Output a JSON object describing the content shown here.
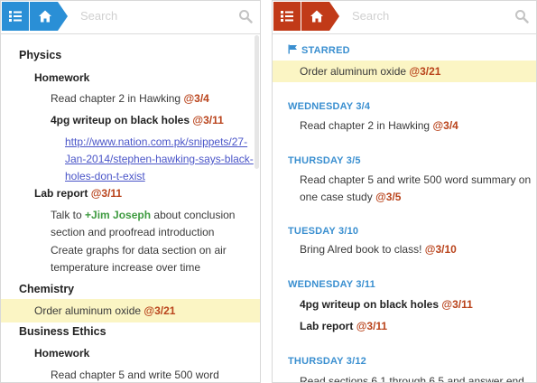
{
  "left": {
    "search_placeholder": "Search",
    "tree": {
      "physics": "Physics",
      "homework": "Homework",
      "item_read_hawking": "Read chapter 2 in Hawking",
      "due_3_4": "@3/4",
      "item_writeup": "4pg writeup on black holes",
      "due_3_11": "@3/11",
      "link_line1": "http://www.nation.com.pk/snippets/27-",
      "link_line2": "Jan-2014/stephen-hawking-says-black-",
      "link_line3": "holes-don-t-exist",
      "lab_report": "Lab report",
      "due_lab": "@3/11",
      "talk_to": "Talk to",
      "mention": "+Jim Joseph",
      "talk_rest": "about conclusion",
      "talk_line2": "section and proofread introduction",
      "graphs_line1": "Create graphs for data section on air",
      "graphs_line2": "temperature increase over time",
      "chemistry": "Chemistry",
      "order": "Order aluminum oxide",
      "due_order": "@3/21",
      "business_ethics": "Business Ethics",
      "homework2": "Homework",
      "read5": "Read chapter 5 and write 500 word"
    }
  },
  "right": {
    "search_placeholder": "Search",
    "starred": "STARRED",
    "starred_item": "Order aluminum oxide",
    "starred_due": "@3/21",
    "wed34": "WEDNESDAY 3/4",
    "wed34_item": "Read chapter 2 in Hawking",
    "wed34_due": "@3/4",
    "thu35": "THURSDAY 3/5",
    "thu35_line1": "Read chapter 5 and write 500 word summary on",
    "thu35_line2": "one case study",
    "thu35_due": "@3/5",
    "tue310": "TUESDAY 3/10",
    "tue310_item": "Bring Alred book to class!",
    "tue310_due": "@3/10",
    "wed311": "WEDNESDAY 3/11",
    "wed311_item1": "4pg writeup on black holes",
    "wed311_due1": "@3/11",
    "wed311_item2": "Lab report",
    "wed311_due2": "@3/11",
    "thu312": "THURSDAY 3/12",
    "thu312_item": "Read sections 6.1 through 6.5 and answer end"
  },
  "colors": {
    "left_accent": "#2a8fd6",
    "right_accent": "#c13a18"
  },
  "icons": [
    "list-icon",
    "home-icon",
    "search-icon",
    "flag-icon"
  ]
}
